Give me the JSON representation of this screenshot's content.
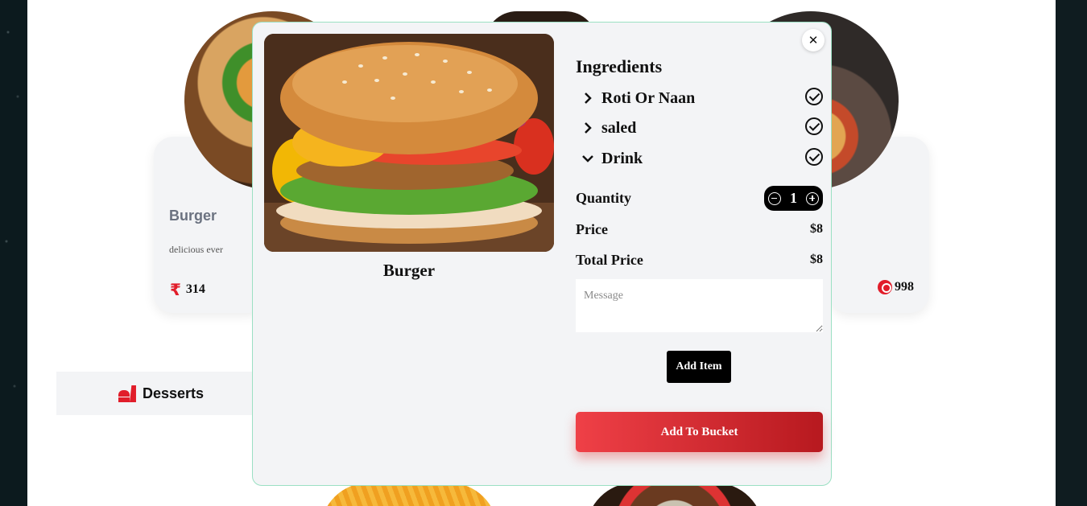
{
  "background_cards": {
    "left": {
      "title": "Burger",
      "description": "delicious ever",
      "price": "314"
    },
    "right": {
      "price": "998"
    }
  },
  "category": {
    "label": "Desserts",
    "icon": "dessert-icon"
  },
  "modal": {
    "close_label": "✕",
    "item_name": "Burger",
    "ingredients_title": "Ingredients",
    "ingredients": [
      {
        "label": "Roti Or Naan",
        "expanded": false,
        "checked": true
      },
      {
        "label": "saled",
        "expanded": false,
        "checked": true
      },
      {
        "label": "Drink",
        "expanded": true,
        "checked": true
      }
    ],
    "quantity_label": "Quantity",
    "quantity_value": "1",
    "price_label": "Price",
    "price_value": "$8",
    "total_label": "Total Price",
    "total_value": "$8",
    "message_placeholder": "Message",
    "add_item_label": "Add Item",
    "add_bucket_label": "Add To Bucket"
  },
  "colors": {
    "accent_red": "#e11d2a",
    "button_gradient_start": "#ef4047",
    "button_gradient_end": "#b7191f",
    "modal_border": "#9be0c3",
    "modal_bg": "#f3f4f6"
  }
}
